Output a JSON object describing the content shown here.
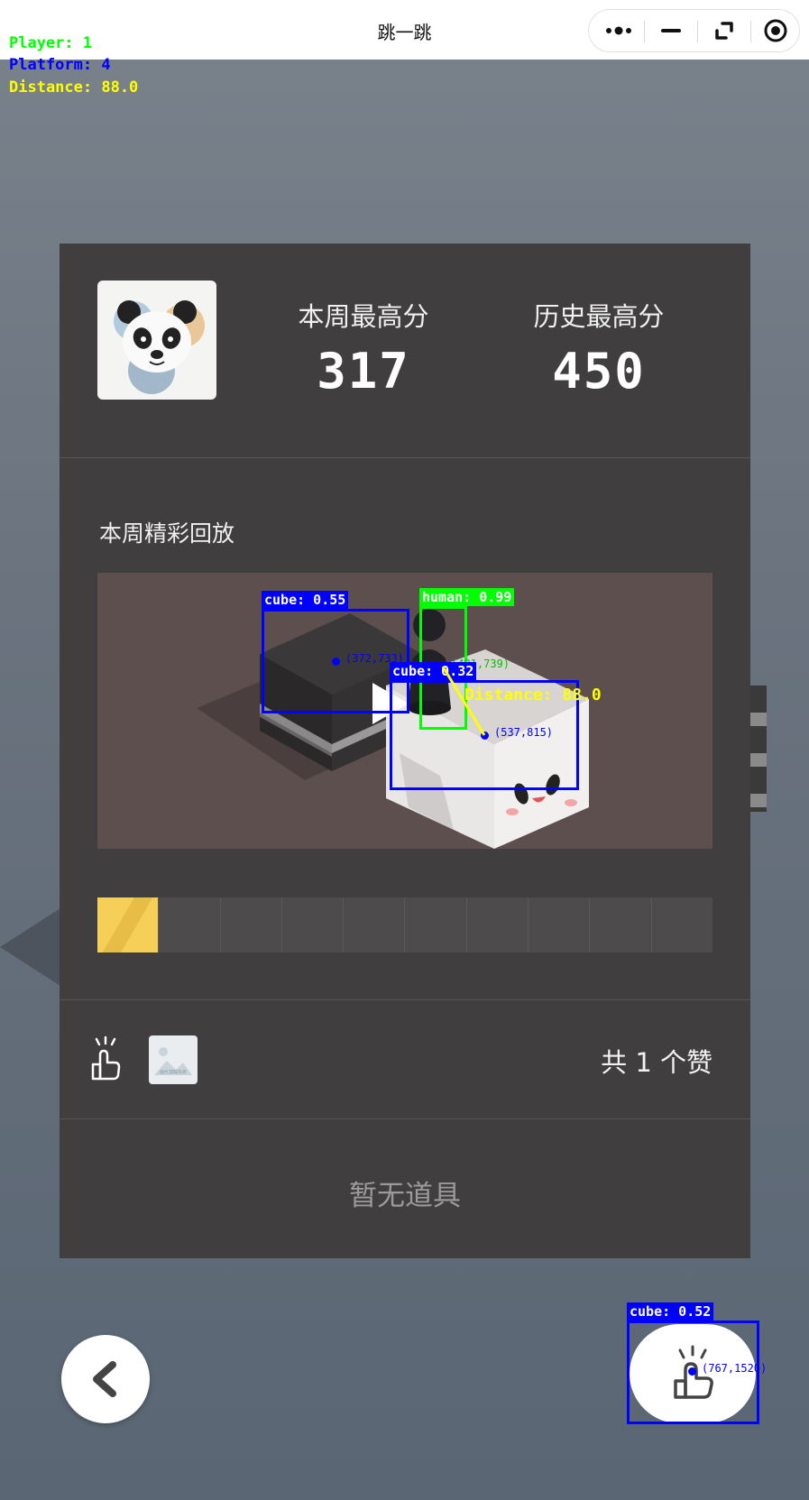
{
  "window": {
    "title": "跳一跳"
  },
  "overlay": {
    "player": "Player: 1",
    "platform": "Platform: 4",
    "distance": "Distance: 88.0",
    "colors": {
      "player": "#00ff00",
      "platform": "#0000ff",
      "distance": "#ffff00"
    }
  },
  "scores": {
    "weekly_label": "本周最高分",
    "weekly_value": "317",
    "alltime_label": "历史最高分",
    "alltime_value": "450"
  },
  "replay": {
    "section_title": "本周精彩回放",
    "progress_segments": 10,
    "active_segment": 1
  },
  "social": {
    "likes_text": "共 1 个赞",
    "image_caption": "图片加载失败"
  },
  "items": {
    "empty_text": "暂无道具"
  },
  "detections": [
    {
      "label": "cube: 0.55",
      "color": "#0000ff",
      "coord": "(372,733)"
    },
    {
      "label": "human: 0.99",
      "color": "#00ff00",
      "coord": "(491,739)"
    },
    {
      "label": "cube: 0.32",
      "color": "#0000ff",
      "coord": "(537,815)"
    },
    {
      "label": "cube: 0.52",
      "color": "#0000ff",
      "coord": "(767,1520)"
    }
  ],
  "distance_line_label": "Distance: 88.0",
  "icons": {
    "more": "more-dots-icon",
    "minimize": "minimize-icon",
    "restore": "restore-icon",
    "close": "target-close-icon",
    "back": "chevron-left-icon",
    "like": "thumb-tap-icon"
  }
}
